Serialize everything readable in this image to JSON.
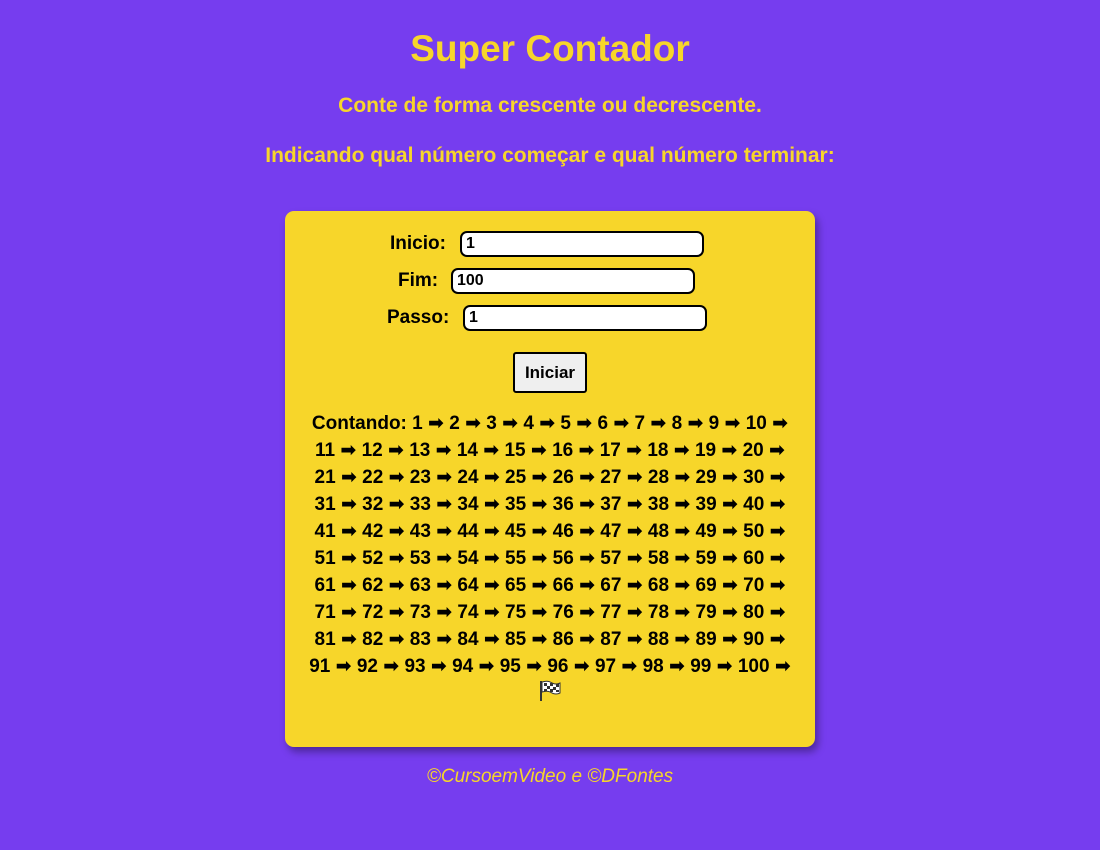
{
  "header": {
    "title": "Super Contador",
    "subtitle_1": "Conte de forma crescente ou decrescente.",
    "subtitle_2": "Indicando qual número começar e qual número terminar:"
  },
  "form": {
    "inicio_label": "Inicio:",
    "inicio_value": "1",
    "fim_label": "Fim:",
    "fim_value": "100",
    "passo_label": "Passo:",
    "passo_value": "1",
    "button_label": "Iniciar"
  },
  "result": {
    "prefix": "Contando:",
    "start": 1,
    "end": 100,
    "step": 1,
    "arrow": "➡",
    "end_icon": "checkered-flag-icon"
  },
  "footer": {
    "text": "©CursoemVideo e ©DFontes"
  },
  "colors": {
    "background": "#763def",
    "accent": "#f7d62a",
    "panel": "#f7d62a",
    "text": "#000000"
  }
}
